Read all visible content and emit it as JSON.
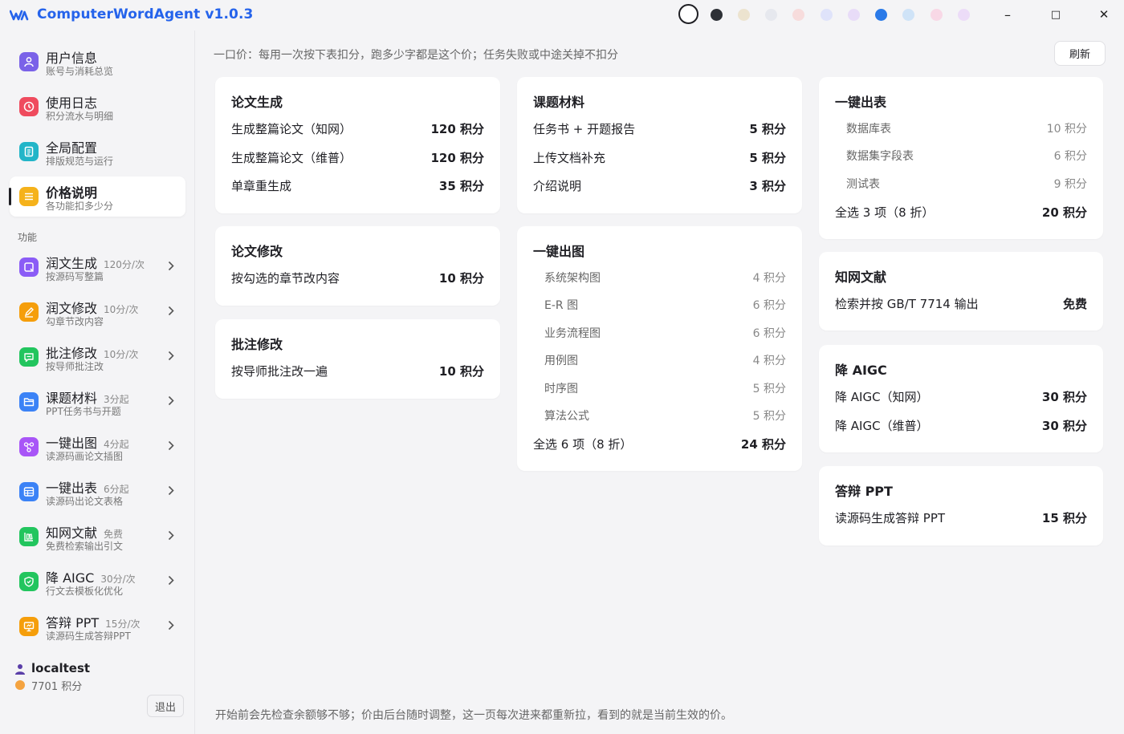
{
  "app": {
    "title": "ComputerWordAgent v1.0.3"
  },
  "theme_swatches": [
    "#ffffff",
    "#2d3036",
    "#ece3cf",
    "#e6e8ee",
    "#f7dcdc",
    "#dfe3fa",
    "#e8dcf8",
    "#2a7ae8",
    "#cfe3f7",
    "#f8d8e6",
    "#ecdcf8"
  ],
  "window_controls": {
    "minimize": "–",
    "maximize": "□",
    "close": "✕"
  },
  "sidebar": {
    "top_items": [
      {
        "label": "用户信息",
        "sub": "账号与消耗总览",
        "icon": "user-icon",
        "color": "#7a62e8"
      },
      {
        "label": "使用日志",
        "sub": "积分流水与明细",
        "icon": "clock-icon",
        "color": "#ef4b5e"
      },
      {
        "label": "全局配置",
        "sub": "排版规范与运行",
        "icon": "document-icon",
        "color": "#22b5c8"
      },
      {
        "label": "价格说明",
        "sub": "各功能扣多少分",
        "icon": "price-list-icon",
        "color": "#f5b21b"
      }
    ],
    "section_label": "功能",
    "feature_items": [
      {
        "label": "润文生成",
        "price": "120分/次",
        "sub": "按源码写整篇",
        "icon": "generate-icon",
        "color": "#8b5cf6"
      },
      {
        "label": "润文修改",
        "price": "10分/次",
        "sub": "勾章节改内容",
        "icon": "edit-icon",
        "color": "#f59e0b"
      },
      {
        "label": "批注修改",
        "price": "10分/次",
        "sub": "按导师批注改",
        "icon": "comment-icon",
        "color": "#22c55e"
      },
      {
        "label": "课题材料",
        "price": "3分起",
        "sub": "PPT任务书与开题",
        "icon": "folder-icon",
        "color": "#3b82f6"
      },
      {
        "label": "一键出图",
        "price": "4分起",
        "sub": "读源码画论文插图",
        "icon": "diagram-icon",
        "color": "#a855f7"
      },
      {
        "label": "一键出表",
        "price": "6分起",
        "sub": "读源码出论文表格",
        "icon": "table-icon",
        "color": "#3b82f6"
      },
      {
        "label": "知网文献",
        "price": "免费",
        "sub": "免费检索输出引文",
        "icon": "library-icon",
        "color": "#22c55e"
      },
      {
        "label": "降 AIGC",
        "price": "30分/次",
        "sub": "行文去模板化优化",
        "icon": "shield-icon",
        "color": "#22c55e"
      },
      {
        "label": "答辩 PPT",
        "price": "15分/次",
        "sub": "读源码生成答辩PPT",
        "icon": "presentation-icon",
        "color": "#f59e0b"
      }
    ],
    "user": {
      "name": "localtest",
      "points": "7701 积分",
      "logout": "退出"
    }
  },
  "main": {
    "notice": "一口价：每用一次按下表扣分，跑多少字都是这个价；任务失败或中途关掉不扣分",
    "refresh": "刷新",
    "footer": "开始前会先检查余额够不够；价由后台随时调整，这一页每次进来都重新拉，看到的就是当前生效的价。",
    "cards": {
      "lunwen": {
        "title": "论文生成",
        "rows": [
          {
            "name": "生成整篇论文（知网）",
            "value": "120 积分"
          },
          {
            "name": "生成整篇论文（维普）",
            "value": "120 积分"
          },
          {
            "name": "单章重生成",
            "value": "35 积分"
          }
        ]
      },
      "xiugai": {
        "title": "论文修改",
        "rows": [
          {
            "name": "按勾选的章节改内容",
            "value": "10 积分"
          }
        ]
      },
      "pizhu": {
        "title": "批注修改",
        "rows": [
          {
            "name": "按导师批注改一遍",
            "value": "10 积分"
          }
        ]
      },
      "keti": {
        "title": "课题材料",
        "rows": [
          {
            "name": "任务书 + 开题报告",
            "value": "5 积分"
          },
          {
            "name": "上传文档补充",
            "value": "5 积分"
          },
          {
            "name": "介绍说明",
            "value": "3 积分"
          }
        ]
      },
      "chutu": {
        "title": "一键出图",
        "sub_rows": [
          {
            "name": "系统架构图",
            "value": "4 积分"
          },
          {
            "name": "E-R 图",
            "value": "6 积分"
          },
          {
            "name": "业务流程图",
            "value": "6 积分"
          },
          {
            "name": "用例图",
            "value": "4 积分"
          },
          {
            "name": "时序图",
            "value": "5 积分"
          },
          {
            "name": "算法公式",
            "value": "5 积分"
          }
        ],
        "total": {
          "name": "全选 6 项（8 折）",
          "value": "24 积分"
        }
      },
      "chubiao": {
        "title": "一键出表",
        "sub_rows": [
          {
            "name": "数据库表",
            "value": "10 积分"
          },
          {
            "name": "数据集字段表",
            "value": "6 积分"
          },
          {
            "name": "测试表",
            "value": "9 积分"
          }
        ],
        "total": {
          "name": "全选 3 项（8 折）",
          "value": "20 积分"
        }
      },
      "zhiwang": {
        "title": "知网文献",
        "rows": [
          {
            "name": "检索并按 GB/T 7714 输出",
            "value": "免费"
          }
        ]
      },
      "aigc": {
        "title": "降 AIGC",
        "rows": [
          {
            "name": "降 AIGC（知网）",
            "value": "30 积分"
          },
          {
            "name": "降 AIGC（维普）",
            "value": "30 积分"
          }
        ]
      },
      "ppt": {
        "title": "答辩 PPT",
        "rows": [
          {
            "name": "读源码生成答辩 PPT",
            "value": "15 积分"
          }
        ]
      }
    }
  }
}
